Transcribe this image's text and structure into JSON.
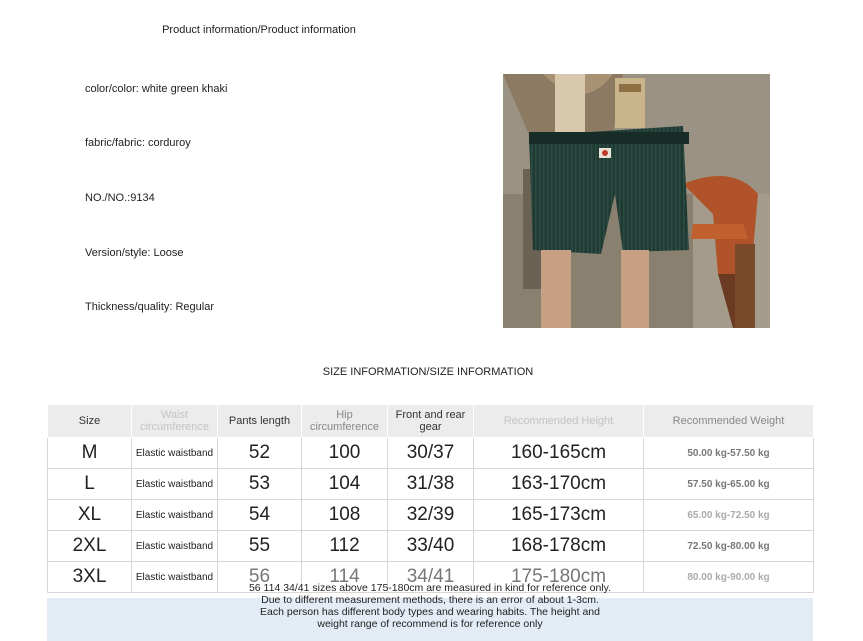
{
  "product": {
    "title": "Product information/Product information",
    "attributes": [
      "color/color: white green khaki",
      "fabric/fabric: corduroy",
      "NO./NO.:9134",
      "Version/style: Loose",
      "Thickness/quality: Regular"
    ]
  },
  "size_info": {
    "title": "SIZE INFORMATION/SIZE INFORMATION",
    "headers": [
      "Size",
      "Waist circumference",
      "Pants length",
      "Hip circumference",
      "Front and rear gear",
      "Recommended Height",
      "Recommended Weight"
    ],
    "rows": [
      {
        "size": "M",
        "waist": "Elastic waistband",
        "length": "52",
        "hip": "100",
        "gear": "30/37",
        "height": "160-165cm",
        "weight": "50.00 kg-57.50 kg"
      },
      {
        "size": "L",
        "waist": "Elastic waistband",
        "length": "53",
        "hip": "104",
        "gear": "31/38",
        "height": "163-170cm",
        "weight": "57.50 kg-65.00 kg"
      },
      {
        "size": "XL",
        "waist": "Elastic waistband",
        "length": "54",
        "hip": "108",
        "gear": "32/39",
        "height": "165-173cm",
        "weight": "65.00 kg-72.50 kg"
      },
      {
        "size": "2XL",
        "waist": "Elastic waistband",
        "length": "55",
        "hip": "112",
        "gear": "33/40",
        "height": "168-178cm",
        "weight": "72.50 kg-80.00 kg"
      },
      {
        "size": "3XL",
        "waist": "Elastic waistband",
        "length": "56",
        "hip": "114",
        "gear": "34/41",
        "height": "175-180cm",
        "weight": "80.00 kg-90.00 kg"
      }
    ],
    "note_lines": [
      "56 114 34/41 sizes above 175-180cm are measured in kind for reference only.",
      "Due to different measurement methods, there is an error of about 1-3cm.",
      "Each person has different body types and wearing habits. The height and",
      "weight range of recommend is for reference only"
    ]
  },
  "colors": {
    "header_bg": "#ececec",
    "note_band": "#e3ecf4",
    "corduroy_green": "#1f3a33"
  }
}
